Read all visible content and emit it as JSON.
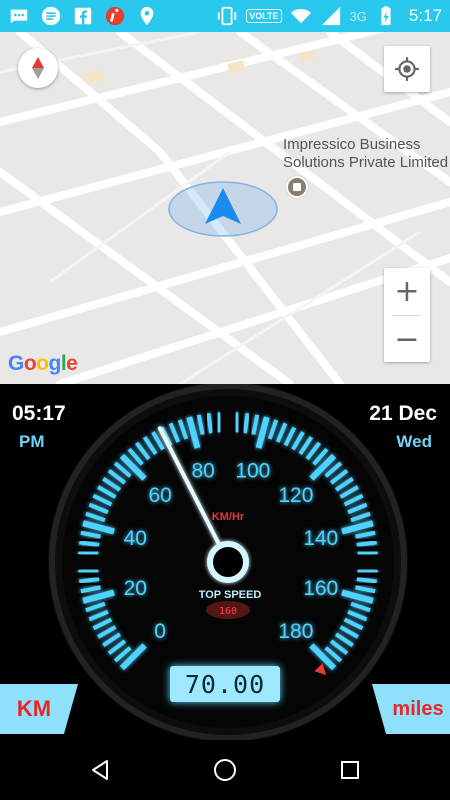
{
  "status_bar": {
    "icons": [
      "messaging-icon",
      "message-icon",
      "facebook-icon",
      "info-app-icon",
      "location-icon",
      "vibrate-icon",
      "volte-icon",
      "wifi-icon",
      "signal-icon",
      "battery-charging-icon"
    ],
    "volte_label": "VOLTE",
    "network_label": "3G",
    "time": "5:17",
    "color": "#29c8ee"
  },
  "map": {
    "poi_name_line1": "Impressico Business",
    "poi_name_line2": "Solutions Private Limited",
    "attribution": "Google",
    "zoom_in_label": "+",
    "zoom_out_label": "−",
    "buttons": [
      "compass-icon",
      "my-location-icon"
    ]
  },
  "speedometer": {
    "time": "05:17",
    "ampm": "PM",
    "date": "21 Dec",
    "weekday": "Wed",
    "unit_label": "KM/Hr",
    "top_speed_label": "TOP SPEED",
    "top_speed_value": "160",
    "digital_speed": "70.00",
    "scale_labels": [
      "0",
      "20",
      "40",
      "60",
      "80",
      "100",
      "120",
      "140",
      "160",
      "180"
    ],
    "scale_min": 0,
    "scale_max": 180,
    "needle_value": 72,
    "accent_color": "#4fd2ff",
    "km_button_label": "KM",
    "miles_button_label": "miles"
  },
  "nav_bar": {
    "buttons": [
      "back-icon",
      "home-icon",
      "recents-icon"
    ]
  }
}
